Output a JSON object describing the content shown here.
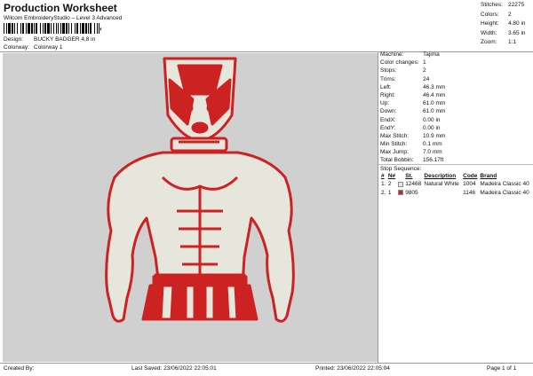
{
  "header": {
    "title": "Production Worksheet",
    "subtitle": "Wilcom EmbroideryStudio – Level 3 Advanced",
    "barcode_suffix": ","
  },
  "meta": [
    {
      "label": "Design:",
      "value": "BUCKY BADGER 4,8 in"
    },
    {
      "label": "Colorway:",
      "value": "Colorway 1"
    }
  ],
  "stats": [
    {
      "label": "Stitches:",
      "value": "22275"
    },
    {
      "label": "Colors:",
      "value": "2"
    },
    {
      "label": "Height:",
      "value": "4.80 in"
    },
    {
      "label": "Width:",
      "value": "3.65 in"
    },
    {
      "label": "Zoom:",
      "value": "1:1"
    }
  ],
  "info": [
    {
      "label": "Machine:",
      "value": "Tajima"
    },
    {
      "label": "Color changes:",
      "value": "1"
    },
    {
      "label": "Stops:",
      "value": "2"
    },
    {
      "label": "Trims:",
      "value": "24"
    },
    {
      "label": "Left:",
      "value": "46.3 mm"
    },
    {
      "label": "Right:",
      "value": "46.4 mm"
    },
    {
      "label": "Up:",
      "value": "61.0 mm"
    },
    {
      "label": "Down:",
      "value": "61.0 mm"
    },
    {
      "label": "EndX:",
      "value": "0.00 in"
    },
    {
      "label": "EndY:",
      "value": "0.00 in"
    },
    {
      "label": "Max Stitch:",
      "value": "10.9 mm"
    },
    {
      "label": "Min Stitch:",
      "value": "0.1 mm"
    },
    {
      "label": "Max Jump:",
      "value": "7.0 mm"
    },
    {
      "label": "Total Bobbin:",
      "value": "156.17ft"
    }
  ],
  "stop_sequence": {
    "title": "Stop Sequence:",
    "headers": [
      "#",
      "N#",
      "",
      "St.",
      "Description",
      "Code",
      "Brand"
    ],
    "rows": [
      {
        "idx": "1.",
        "n": "2",
        "color": "#e8e8e0",
        "st": "12468",
        "desc": "Natural White",
        "code": "1004",
        "brand": "Madeira Classic 40"
      },
      {
        "idx": "2.",
        "n": "1",
        "color": "#cc2222",
        "st": "9805",
        "desc": "",
        "code": "1146",
        "brand": "Madeira Classic 40"
      }
    ]
  },
  "footer": {
    "created": "Created By:",
    "saved": "Last Saved: 23/06/2022 22:05:01",
    "printed": "Printed: 23/06/2022 22:05:04",
    "page": "Page 1 of 1"
  },
  "colors": {
    "thread_red": "#cc2222",
    "thread_white": "#e8e8e0",
    "preview_bg": "#d0d0d0"
  }
}
